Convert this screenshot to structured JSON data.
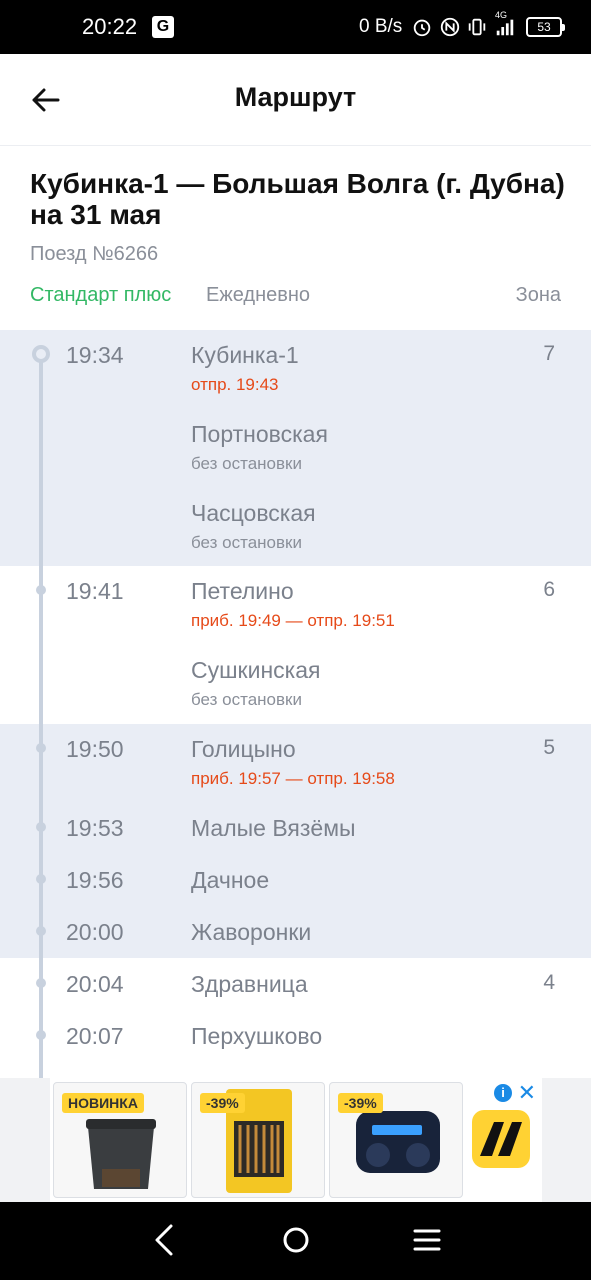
{
  "status_bar": {
    "time": "20:22",
    "g_label": "G",
    "net_rate": "0 B/s",
    "network_type": "4G",
    "battery": "53",
    "icons": [
      "alarm-icon",
      "nfc-icon",
      "vibrate-icon",
      "signal-icon",
      "battery-icon"
    ]
  },
  "header": {
    "title": "Маршрут",
    "back_icon": "arrow-left-icon"
  },
  "route": {
    "title": "Кубинка-1 — Большая Волга (г. Дубна) на 31 мая",
    "train": "Поезд №6266",
    "category": "Стандарт плюс",
    "frequency": "Ежедневно",
    "zone_header": "Зона"
  },
  "stops": [
    {
      "time": "19:34",
      "name": "Кубинка-1",
      "sub": "отпр. 19:43",
      "zone": "7"
    },
    {
      "time": "",
      "name": "Портновская",
      "sub": "без остановки",
      "zone": ""
    },
    {
      "time": "",
      "name": "Часцовская",
      "sub": "без остановки",
      "zone": ""
    },
    {
      "time": "19:41",
      "name": "Петелино",
      "sub": "приб. 19:49 — отпр. 19:51",
      "zone": "6"
    },
    {
      "time": "",
      "name": "Сушкинская",
      "sub": "без остановки",
      "zone": ""
    },
    {
      "time": "19:50",
      "name": "Голицыно",
      "sub": "приб. 19:57 — отпр. 19:58",
      "zone": "5"
    },
    {
      "time": "19:53",
      "name": "Малые Вязёмы",
      "sub": "",
      "zone": ""
    },
    {
      "time": "19:56",
      "name": "Дачное",
      "sub": "",
      "zone": ""
    },
    {
      "time": "20:00",
      "name": "Жаворонки",
      "sub": "",
      "zone": ""
    },
    {
      "time": "20:04",
      "name": "Здравница",
      "sub": "",
      "zone": "4"
    },
    {
      "time": "20:07",
      "name": "Перхушково",
      "sub": "",
      "zone": ""
    }
  ],
  "ad": {
    "tiles": [
      {
        "badge": "НОВИНКА"
      },
      {
        "badge": "-39%"
      },
      {
        "badge": "-39%"
      }
    ],
    "info": "i",
    "close": "✕",
    "colors": {
      "accent": "#1a8ae5",
      "badge": "#ffd233"
    }
  },
  "nav": [
    "back-nav-icon",
    "home-nav-icon",
    "menu-nav-icon"
  ],
  "colors": {
    "green": "#33b865",
    "red": "#e64a19",
    "shade": "#e9edf5"
  }
}
